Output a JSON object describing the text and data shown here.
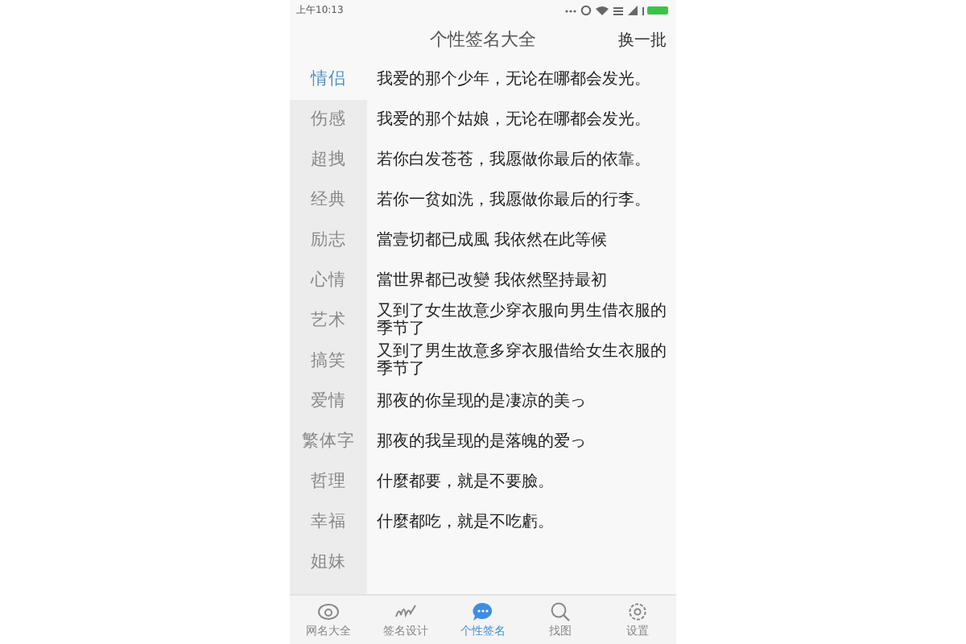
{
  "status_bar": {
    "time": "上午10:13"
  },
  "header": {
    "title": "个性签名大全",
    "action": "换一批"
  },
  "categories": [
    {
      "label": "情侣",
      "selected": true
    },
    {
      "label": "伤感",
      "selected": false
    },
    {
      "label": "超拽",
      "selected": false
    },
    {
      "label": "经典",
      "selected": false
    },
    {
      "label": "励志",
      "selected": false
    },
    {
      "label": "心情",
      "selected": false
    },
    {
      "label": "艺术",
      "selected": false
    },
    {
      "label": "搞笑",
      "selected": false
    },
    {
      "label": "爱情",
      "selected": false
    },
    {
      "label": "繁体字",
      "selected": false
    },
    {
      "label": "哲理",
      "selected": false
    },
    {
      "label": "幸福",
      "selected": false
    },
    {
      "label": "姐妹",
      "selected": false
    }
  ],
  "signatures": [
    "我爱的那个少年，无论在哪都会发光。",
    "我爱的那个姑娘，无论在哪都会发光。",
    "若你白发苍苍，我愿做你最后的依靠。",
    "若你一贫如洗，我愿做你最后的行李。",
    "當壹切都已成風 我依然在此等候",
    "當世界都已改變 我依然堅持最初",
    "又到了女生故意少穿衣服向男生借衣服的季节了",
    "又到了男生故意多穿衣服借给女生衣服的季节了",
    "那夜的你呈现的是凄凉的美っ",
    "那夜的我呈现的是落魄的爱っ",
    "什麼都要，就是不要臉。",
    "什麼都吃，就是不吃虧。"
  ],
  "tabs": [
    {
      "label": "网名大全",
      "kind": "eye",
      "selected": false
    },
    {
      "label": "签名设计",
      "kind": "signature",
      "selected": false
    },
    {
      "label": "个性签名",
      "kind": "chat",
      "selected": true
    },
    {
      "label": "找图",
      "kind": "search",
      "selected": false
    },
    {
      "label": "设置",
      "kind": "gear",
      "selected": false
    }
  ]
}
